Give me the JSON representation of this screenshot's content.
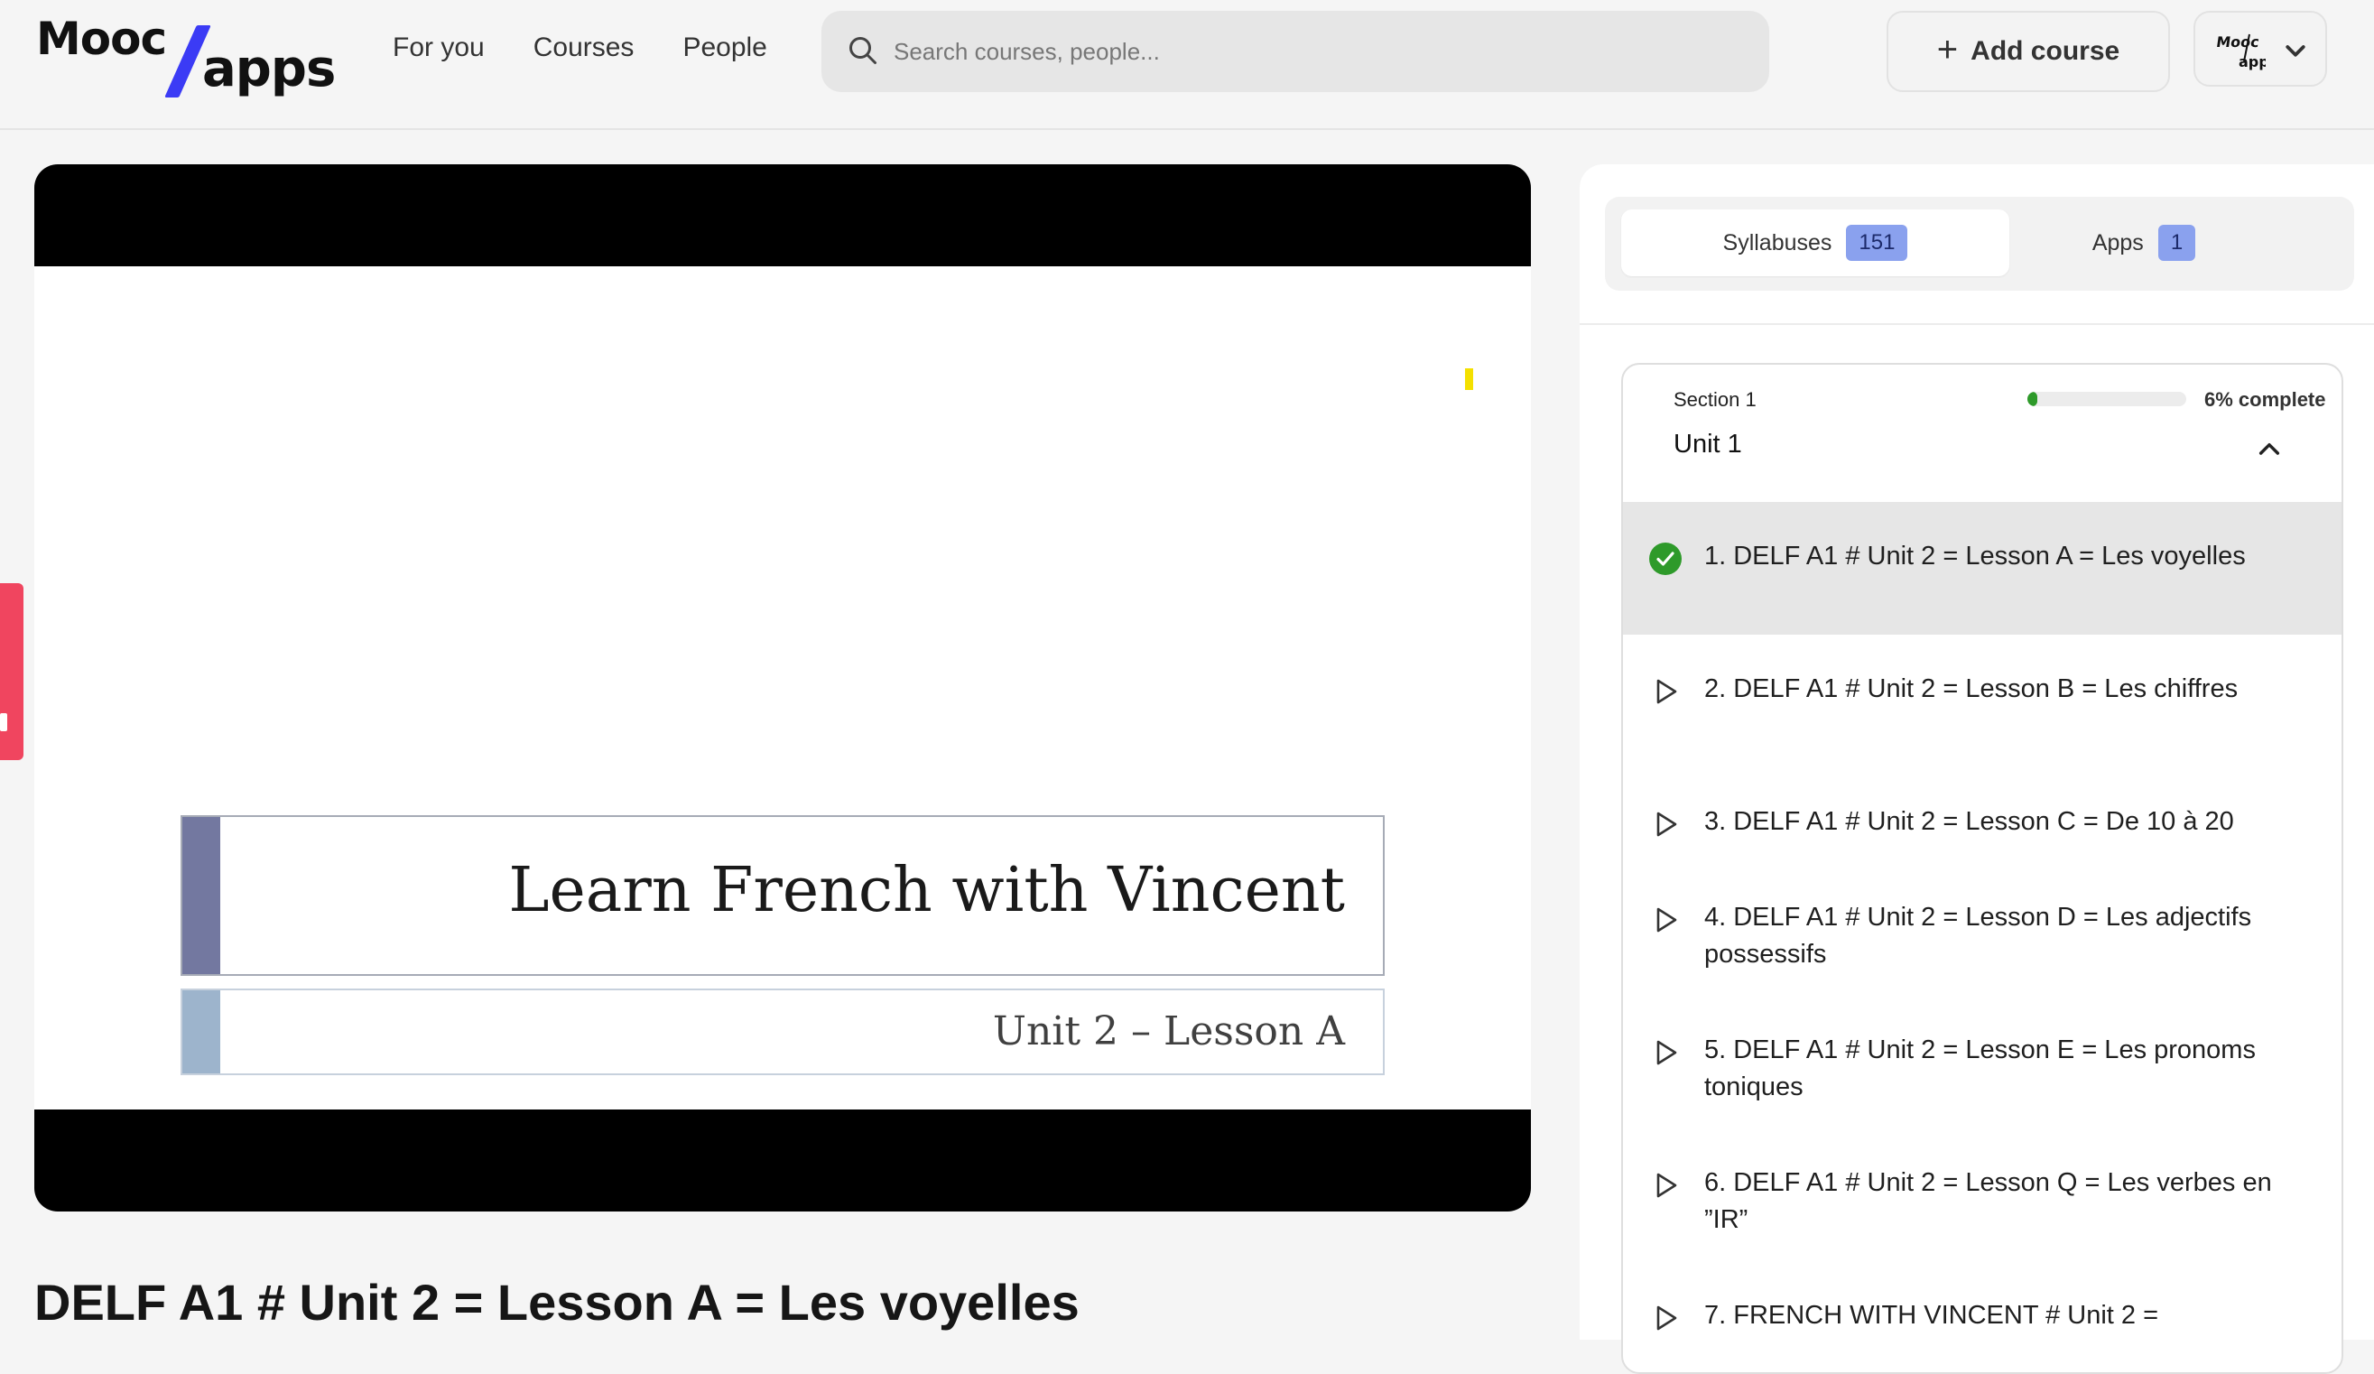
{
  "header": {
    "logo_mooc": "Mooc",
    "logo_apps": "apps",
    "nav": [
      "For you",
      "Courses",
      "People"
    ],
    "search_placeholder": "Search courses, people...",
    "add_course": "Add course",
    "add_icon": "plus-icon",
    "profile_icon": "chevron-down-icon"
  },
  "video": {
    "slide_title": "Learn French with Vincent",
    "slide_subtitle": "Unit 2 – Lesson A"
  },
  "lesson_title": "DELF A1 # Unit 2 = Lesson A = Les voyelles",
  "panel": {
    "tabs": [
      {
        "label": "Syllabuses",
        "count": "151",
        "active": true
      },
      {
        "label": "Apps",
        "count": "1",
        "active": false
      }
    ],
    "section": {
      "label": "Section 1",
      "unit": "Unit 1",
      "progress_fraction": 0.06,
      "progress_text": "6% complete",
      "lessons": [
        {
          "text": "1. DELF A1 # Unit 2 = Lesson A = Les voyelles",
          "status": "done",
          "active": true
        },
        {
          "text": "2. DELF A1 # Unit 2 = Lesson B = Les chiffres",
          "status": "play"
        },
        {
          "text": "3. DELF A1 # Unit 2 = Lesson C = De 10 à 20",
          "status": "play"
        },
        {
          "text": "4. DELF A1 # Unit 2 = Lesson D = Les adjectifs possessifs",
          "status": "play"
        },
        {
          "text": "5. DELF A1 # Unit 2 = Lesson E = Les pronoms toniques",
          "status": "play"
        },
        {
          "text": "6. DELF A1 # Unit 2 = Lesson Q = Les verbes en ”IR”",
          "status": "play"
        },
        {
          "text": "7. FRENCH WITH VINCENT # Unit 2 =",
          "status": "play"
        }
      ]
    }
  },
  "colors": {
    "accent_blue": "#3b3bf5",
    "success_green": "#2e9a2a",
    "badge_blue": "#8aa1ee",
    "side_tab_red": "#f0455f"
  }
}
